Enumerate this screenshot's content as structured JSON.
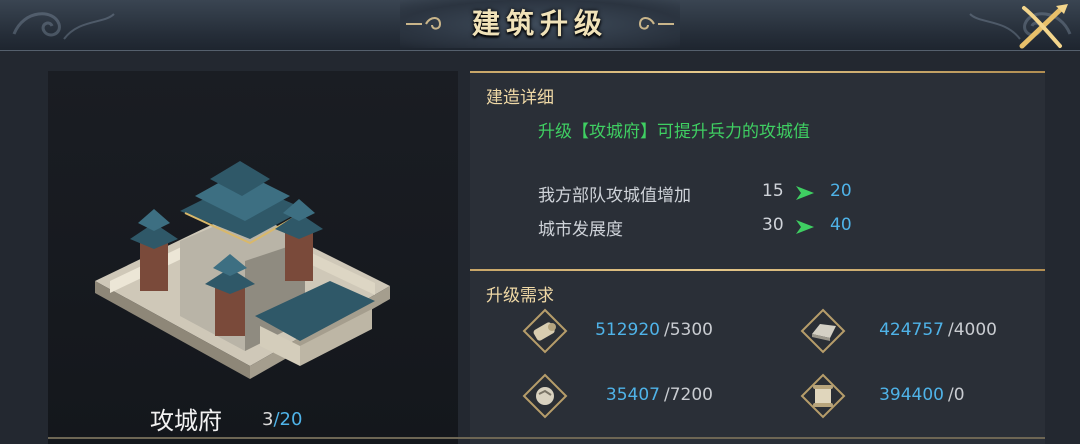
{
  "header": {
    "title": "建筑升级",
    "close_icon": "close-crossed-blades-icon"
  },
  "building": {
    "name": "攻城府",
    "level": "3",
    "level_sep": "/",
    "level_max": "20"
  },
  "details": {
    "title": "建造详细",
    "description": "升级【攻城府】可提升兵力的攻城值",
    "stats": [
      {
        "label": "我方部队攻城值增加",
        "from": "15",
        "to": "20"
      },
      {
        "label": "城市发展度",
        "from": "30",
        "to": "40"
      }
    ]
  },
  "requirements": {
    "title": "升级需求",
    "items": [
      {
        "icon": "wood-log-icon",
        "have": "512920",
        "need": "/5300"
      },
      {
        "icon": "iron-ingot-icon",
        "have": "424757",
        "need": "/4000"
      },
      {
        "icon": "stone-ore-icon",
        "have": "35407",
        "need": "/7200"
      },
      {
        "icon": "scroll-decree-icon",
        "have": "394400",
        "need": "/0"
      }
    ]
  },
  "colors": {
    "accent_gold": "#e6c98b",
    "value_blue": "#4fb3e8",
    "positive_green": "#3fcf62"
  }
}
